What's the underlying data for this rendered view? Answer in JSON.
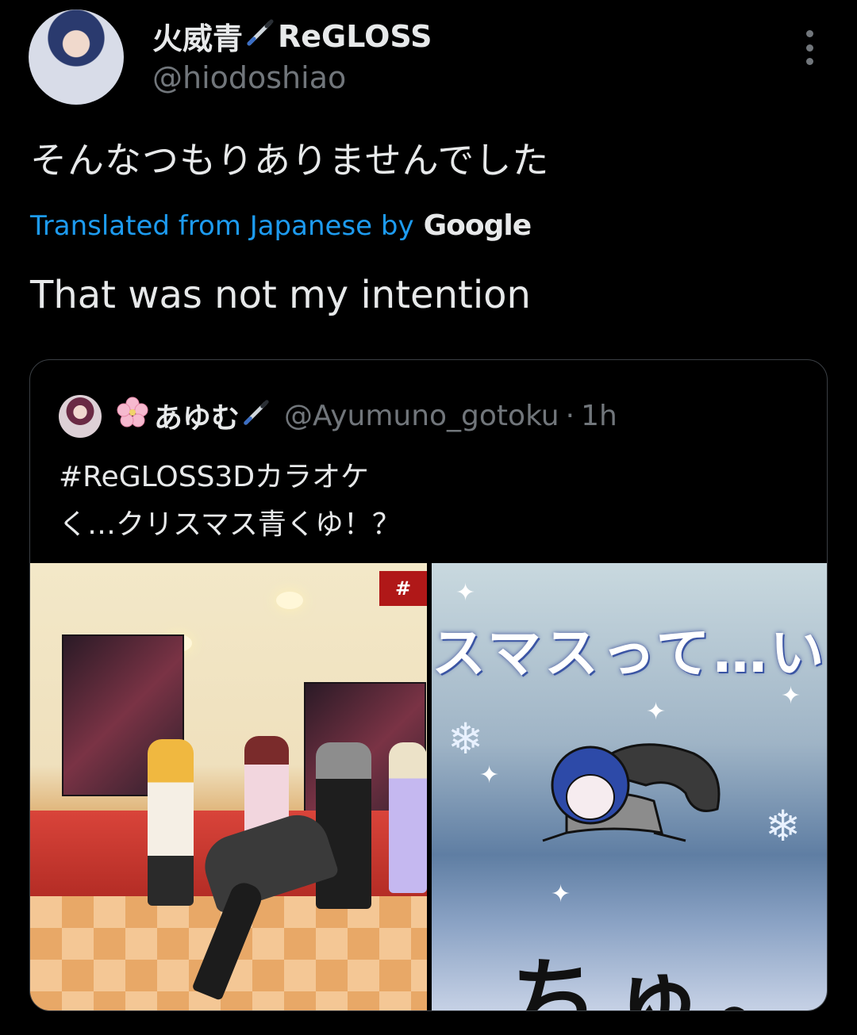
{
  "tweet": {
    "author_name": "火威青",
    "author_suffix": "ReGLOSS",
    "handle": "@hiodoshiao",
    "text_ja": "そんなつもりありませんでした",
    "translation_label": "Translated from Japanese by",
    "translation_provider": "Google",
    "text_en": "That was not my intention"
  },
  "quoted": {
    "author_name": "あゆむ",
    "handle": "@Ayumuno_gotoku",
    "separator": "·",
    "time": "1h",
    "line1": "#ReGLOSS3Dカラオケ",
    "line2": "く…クリスマス青くゆ！？",
    "media_right_overlay": "スマスって…い",
    "media_right_bottom": "ちゅ。",
    "media_left_badge": "#"
  },
  "icons": {
    "more": "more-vertical-icon",
    "pen": "pen-icon",
    "flower": "cherry-blossom-icon"
  },
  "colors": {
    "background": "#000000",
    "text": "#e7e9ea",
    "muted": "#71767b",
    "link": "#1d9bf0",
    "border": "#3a3f44"
  }
}
